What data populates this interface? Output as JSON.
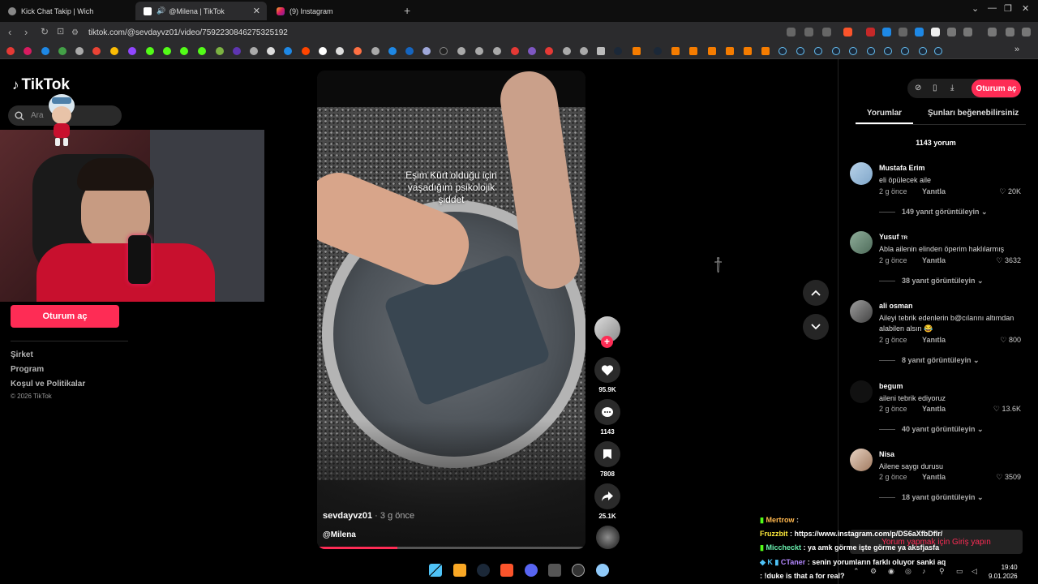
{
  "browser": {
    "tabs": [
      {
        "label": "Kick Chat Takip | Wich",
        "active": false
      },
      {
        "label": "@Milena | TikTok",
        "active": true
      },
      {
        "label": "(9) Instagram",
        "active": false
      }
    ],
    "url": "tiktok.com/@sevdayvz01/video/7592230846275325192"
  },
  "tiktok": {
    "logo": "TikTok",
    "search_placeholder": "Ara",
    "login_label": "Oturum aç",
    "footer": [
      "Şirket",
      "Program",
      "Koşul ve Politikalar"
    ],
    "copyright": "© 2026 TikTok"
  },
  "video": {
    "caption": [
      "Eşim Kürt olduğu için",
      "yaşadığım psikolojik",
      "şiddet"
    ],
    "author": "sevdayvz01",
    "time": "· 3 g önce",
    "music": "@Milena",
    "progress": 0.3
  },
  "actions": {
    "likes": "95.9K",
    "comments": "1143",
    "saves": "7808",
    "shares": "25.1K"
  },
  "panel": {
    "login_label": "Oturum aç",
    "tabs": [
      "Yorumlar",
      "Şunları beğenebilirsiniz"
    ],
    "comment_count": "1143 yorum",
    "comments": [
      {
        "name": "Mustafa Erim",
        "text": "eli öpülecek aile",
        "time": "2 g önce",
        "reply": "Yanıtla",
        "likes": "20K",
        "more": "149 yanıt görüntüleyin"
      },
      {
        "name": "Yusuf",
        "badge": "TR",
        "text": "Abla ailenin elinden öperim haklılarmış",
        "time": "2 g önce",
        "reply": "Yanıtla",
        "likes": "3632",
        "more": "38 yanıt görüntüleyin"
      },
      {
        "name": "ali osman",
        "text": "Aileyi tebrik edenlerin b@cılarını altımdan alabilen alsın 😂",
        "time": "2 g önce",
        "reply": "Yanıtla",
        "likes": "800",
        "more": "8 yanıt görüntüleyin"
      },
      {
        "name": "begum",
        "text": "aileni tebrik ediyoruz",
        "time": "2 g önce",
        "reply": "Yanıtla",
        "likes": "13.6K",
        "more": "40 yanıt görüntüleyin"
      },
      {
        "name": "Nisa",
        "text": "Ailene saygı durusu",
        "time": "2 g önce",
        "reply": "Yanıtla",
        "likes": "3509",
        "more": "18 yanıt görüntüleyin"
      }
    ],
    "login_prompt": "Yorum yapmak için Giriş yapın"
  },
  "chat": [
    {
      "user": "Mertrow",
      "text": ":"
    },
    {
      "user": "Fruzzbit",
      "text": ": https://www.instagram.com/p/DS6aXfbDflr/"
    },
    {
      "user": "Miccheckt",
      "text": ": ya amk görme işte görme ya aksfjasfa"
    },
    {
      "user": "CTaner",
      "text": ": senin yorumların farklı oluyor sanki aq"
    },
    {
      "user": "",
      "text": ": !duke is that a for real?"
    }
  ],
  "clock": {
    "time": "19:40",
    "date": "9.01.2026"
  },
  "colors": {
    "accent": "#fe2c55"
  }
}
